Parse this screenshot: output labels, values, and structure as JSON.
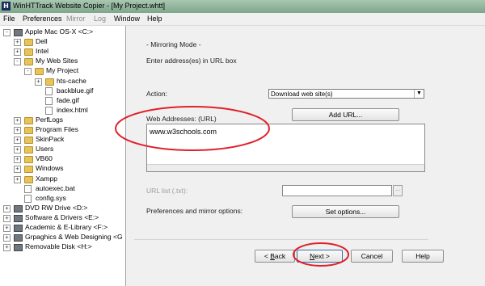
{
  "window": {
    "title": "WinHTTrack Website Copier - [My Project.whtt]",
    "app_icon_letter": "H"
  },
  "menu": {
    "items": [
      "File",
      "Preferences",
      "Mirror",
      "Log",
      "Window",
      "Help"
    ]
  },
  "tree": {
    "items": [
      {
        "label": "Apple Mac OS-X <C:>",
        "kind": "drive",
        "expander": "-"
      },
      {
        "label": "Dell",
        "kind": "folder",
        "expander": "+"
      },
      {
        "label": "Intel",
        "kind": "folder",
        "expander": "+"
      },
      {
        "label": "My Web Sites",
        "kind": "folder",
        "expander": "-"
      },
      {
        "label": "My Project",
        "kind": "folder",
        "expander": "-"
      },
      {
        "label": "hts-cache",
        "kind": "folder",
        "expander": "+"
      },
      {
        "label": "backblue.gif",
        "kind": "file",
        "expander": ""
      },
      {
        "label": "fade.gif",
        "kind": "file",
        "expander": ""
      },
      {
        "label": "index.html",
        "kind": "file",
        "expander": ""
      },
      {
        "label": "PerfLogs",
        "kind": "folder",
        "expander": "+"
      },
      {
        "label": "Program Files",
        "kind": "folder",
        "expander": "+"
      },
      {
        "label": "SkinPack",
        "kind": "folder",
        "expander": "+"
      },
      {
        "label": "Users",
        "kind": "folder",
        "expander": "+"
      },
      {
        "label": "VB60",
        "kind": "folder",
        "expander": "+"
      },
      {
        "label": "Windows",
        "kind": "folder",
        "expander": "+"
      },
      {
        "label": "Xampp",
        "kind": "folder",
        "expander": "+"
      },
      {
        "label": "autoexec.bat",
        "kind": "file",
        "expander": ""
      },
      {
        "label": "config.sys",
        "kind": "file",
        "expander": ""
      },
      {
        "label": "DVD RW Drive <D:>",
        "kind": "drive",
        "expander": "+"
      },
      {
        "label": "Software & Drivers <E:>",
        "kind": "drive",
        "expander": "+"
      },
      {
        "label": "Academic & E-Library <F:>",
        "kind": "drive",
        "expander": "+"
      },
      {
        "label": "Grpaghics & Web Designing <G",
        "kind": "drive",
        "expander": "+"
      },
      {
        "label": "Removable Disk <H:>",
        "kind": "drive",
        "expander": "+"
      }
    ]
  },
  "panel": {
    "mode_heading": "- Mirroring Mode -",
    "instruction": "Enter address(es) in URL box",
    "action_label": "Action:",
    "action_value": "Download web site(s)",
    "web_addresses_label": "Web Addresses: (URL)",
    "add_url_button": "Add URL...",
    "url_value": "www.w3schools.com",
    "url_list_label": "URL list (.txt):",
    "url_list_browse": "...",
    "prefs_label": "Preferences and mirror options:",
    "set_options_button": "Set options..."
  },
  "footer": {
    "back_prefix": "< ",
    "back_accel": "B",
    "back_rest": "ack",
    "next_accel": "N",
    "next_rest": "ext >",
    "cancel_button": "Cancel",
    "help_button": "Help"
  },
  "annotation_color": "#e0202a"
}
